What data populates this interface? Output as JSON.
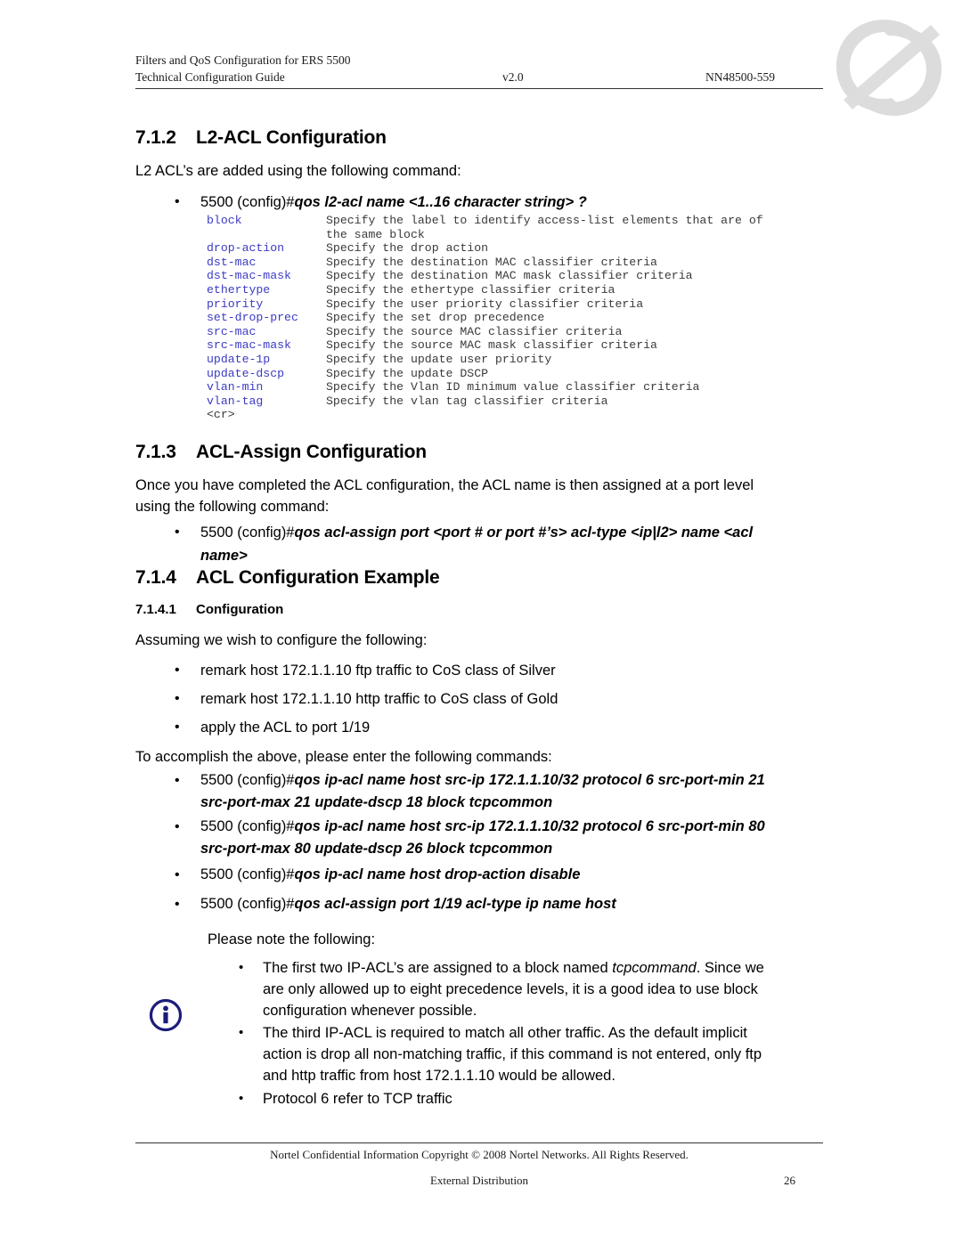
{
  "document": {
    "header": {
      "line1": "Filters and QoS Configuration for ERS 5500",
      "line2_left": "Technical Configuration Guide",
      "line2_mid": "v2.0",
      "line2_right": "NN48500-559"
    },
    "footer": {
      "confidential": "Nortel Confidential Information   Copyright © 2008 Nortel Networks. All Rights Reserved.",
      "distribution": "External Distribution",
      "page_number": "26"
    },
    "logo": "nortel-globe-logo"
  },
  "sections": {
    "s712": {
      "number": "7.1.2",
      "title": "L2-ACL Configuration",
      "intro": "L2 ACL’s are added using the following command:",
      "command_prefix": "5500 (config)#",
      "command_bold": "qos l2-acl name <1..16 character string> ?"
    },
    "s713": {
      "number": "7.1.3",
      "title": "ACL-Assign Configuration",
      "intro_line1": "Once you have completed the ACL configuration, the ACL name is then assigned at a port level",
      "intro_line2": "using the following command:",
      "command_prefix": "5500 (config)#",
      "command_bold_line1": "qos acl-assign  port <port # or port #’s> acl-type <ip|l2> name <acl",
      "command_bold_line2": "name>"
    },
    "s714": {
      "number": "7.1.4",
      "title": "ACL Configuration Example"
    },
    "s7141": {
      "number": "7.1.4.1",
      "title": "Configuration",
      "intro": "Assuming we wish to configure the following:",
      "requirements": [
        "remark host 172.1.1.10 ftp traffic to CoS class of Silver",
        "remark host 172.1.1.10 http traffic to CoS class of Gold",
        "apply the ACL to port 1/19"
      ],
      "commands_intro": "To accomplish the above, please enter the following commands:",
      "commands": [
        {
          "prefix": "5500 (config)#",
          "bold_line1": "qos ip-acl name host src-ip 172.1.1.10/32 protocol 6 src-port-min 21",
          "bold_line2": "src-port-max 21 update-dscp 18 block tcpcommon"
        },
        {
          "prefix": "5500 (config)#",
          "bold_line1": "qos ip-acl name host src-ip 172.1.1.10/32 protocol 6 src-port-min 80",
          "bold_line2": "src-port-max 80 update-dscp 26 block tcpcommon"
        },
        {
          "prefix": "5500 (config)#",
          "bold_line1": "qos ip-acl name host drop-action disable",
          "bold_line2": ""
        },
        {
          "prefix": "5500 (config)#",
          "bold_line1": "qos acl-assign port 1/19 acl-type ip name host",
          "bold_line2": ""
        }
      ],
      "note_intro": "Please note the following:",
      "notes": [
        {
          "line1_a": "The first two IP-ACL’s are assigned to a block named ",
          "line1_em": "tcpcommand",
          "line1_b": ". Since we",
          "line2": "are only allowed up to eight precedence levels, it is a good idea to use block",
          "line3": "configuration whenever possible."
        },
        {
          "line1_a": "The third IP-ACL is required to match all other traffic. As the default  implicit",
          "line1_em": "",
          "line1_b": "",
          "line2": "action is drop all non-matching traffic, if this command is not entered, only ftp",
          "line3": "and http traffic from host 172.1.1.10 would be allowed."
        },
        {
          "line1_a": "Protocol 6 refer to TCP traffic",
          "line1_em": "",
          "line1_b": "",
          "line2": "",
          "line3": ""
        }
      ]
    }
  },
  "cli_help": {
    "rows": [
      {
        "keyword": "block",
        "desc": "Specify the label to identify access-list elements that are of"
      },
      {
        "keyword": "",
        "desc": "the same block"
      },
      {
        "keyword": "drop-action",
        "desc": "Specify the drop action"
      },
      {
        "keyword": "dst-mac",
        "desc": "Specify the destination MAC classifier criteria"
      },
      {
        "keyword": "dst-mac-mask",
        "desc": "Specify the destination MAC mask classifier criteria"
      },
      {
        "keyword": "ethertype",
        "desc": "Specify the ethertype classifier criteria"
      },
      {
        "keyword": "priority",
        "desc": "Specify the user priority classifier criteria"
      },
      {
        "keyword": "set-drop-prec",
        "desc": "Specify the set drop precedence"
      },
      {
        "keyword": "src-mac",
        "desc": "Specify the source MAC classifier criteria"
      },
      {
        "keyword": "src-mac-mask",
        "desc": "Specify the source MAC mask classifier criteria"
      },
      {
        "keyword": "update-1p",
        "desc": "Specify the update user priority"
      },
      {
        "keyword": "update-dscp",
        "desc": "Specify the update DSCP"
      },
      {
        "keyword": "vlan-min",
        "desc": "Specify the Vlan ID minimum value classifier criteria"
      },
      {
        "keyword": "vlan-tag",
        "desc": "Specify the vlan tag classifier criteria"
      },
      {
        "keyword": "<cr>",
        "desc": ""
      }
    ]
  },
  "icons": {
    "info": "info-circle-icon",
    "bullet_glyph": "•"
  },
  "colors": {
    "cli_keyword": "#3b3bc4",
    "info_icon": "#1c1c7a",
    "watermark": "#dcdcdc",
    "rule": "#333333"
  }
}
